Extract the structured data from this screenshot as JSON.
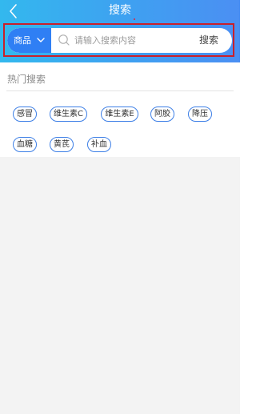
{
  "header": {
    "title": "搜索",
    "back_icon": "chevron-left-icon"
  },
  "search": {
    "category_label": "商品",
    "category_icon": "chevron-down-icon",
    "search_icon": "search-icon",
    "placeholder": "请输入搜索内容",
    "value": "",
    "button_label": "搜索"
  },
  "hot": {
    "title": "热门搜索",
    "tags": [
      "感冒",
      "维生素C",
      "维生素E",
      "阿胶",
      "降压",
      "血糖",
      "黄芪",
      "补血"
    ]
  },
  "colors": {
    "header_gradient": [
      "#33b8ee",
      "#4b8ff3"
    ],
    "category_bg": "#2f7ff4",
    "tag_border": "#3d7fe6",
    "highlight_border": "#c9202b"
  }
}
